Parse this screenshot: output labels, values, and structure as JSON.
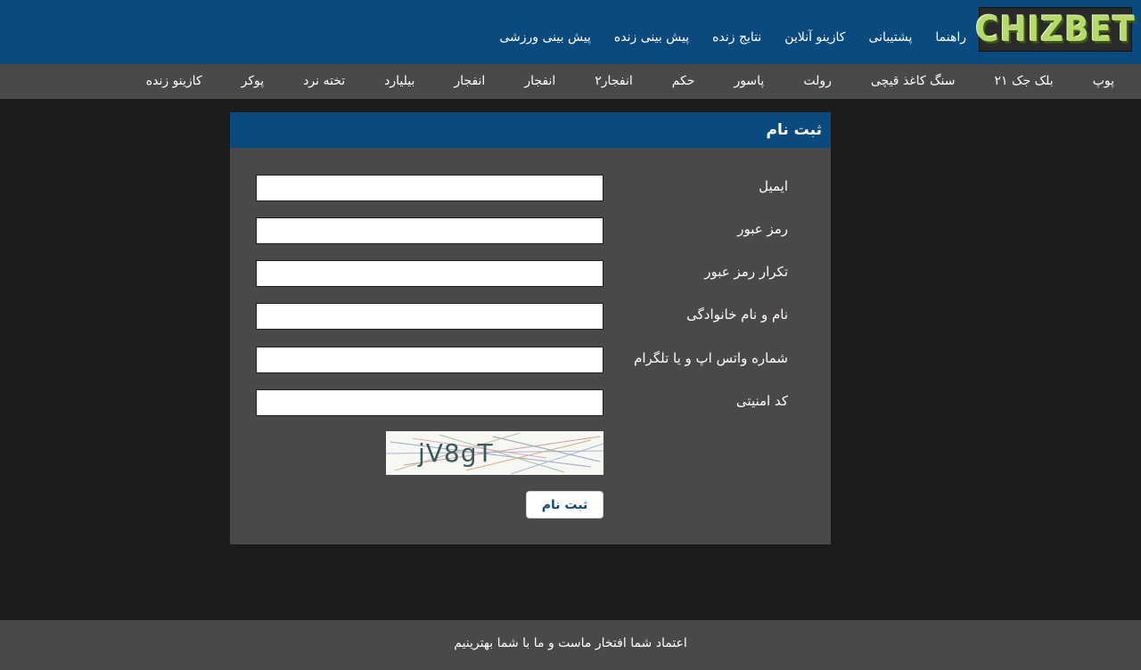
{
  "header": {
    "logo_text": "CHIZBET",
    "nav": [
      "پیش بینی ورزشی",
      "پیش بینی زنده",
      "نتایج زنده",
      "کازینو آنلاین",
      "پشتیبانی",
      "راهنما"
    ]
  },
  "games_nav": [
    "کازینو زنده",
    "پوکر",
    "تخته نرد",
    "بیلیارد",
    "انفجار",
    "انفجار",
    "انفجار۲",
    "حکم",
    "پاسور",
    "رولت",
    "سنگ کاغذ قیچی",
    "بلک جک ۲۱",
    "پوپ"
  ],
  "form": {
    "title": "ثبت نام",
    "fields": [
      {
        "label": "ایمیل",
        "value": ""
      },
      {
        "label": "رمز عبور",
        "value": ""
      },
      {
        "label": "تکرار رمز عبور",
        "value": ""
      },
      {
        "label": "نام و نام خانوادگی",
        "value": ""
      },
      {
        "label": "شماره واتس اپ و یا تلگرام",
        "value": ""
      },
      {
        "label": "کد امنیتی",
        "value": ""
      }
    ],
    "captcha_text": "jV8gT",
    "submit_label": "ثبت نام"
  },
  "footer": {
    "text": "اعتماد شما افتخار ماست و ما با شما بهترینیم"
  },
  "colors": {
    "brand_blue": "#0b4a7e",
    "panel_gray": "#4b484b",
    "background": "#1c1c1c"
  }
}
